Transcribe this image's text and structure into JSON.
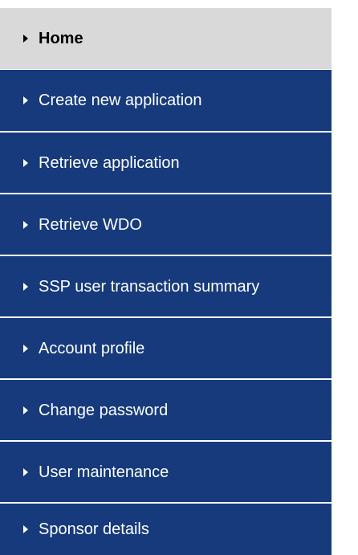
{
  "menu": {
    "colors": {
      "active_bg": "#d9d9d9",
      "active_text": "#000000",
      "item_bg": "#163a7b",
      "item_text": "#ffffff",
      "separator": "#ffffff"
    },
    "items": [
      {
        "label": "Home",
        "active": true,
        "icon": "triangle-right-icon"
      },
      {
        "label": "Create new application",
        "active": false,
        "icon": "triangle-right-icon"
      },
      {
        "label": "Retrieve application",
        "active": false,
        "icon": "triangle-right-icon"
      },
      {
        "label": "Retrieve WDO",
        "active": false,
        "icon": "triangle-right-icon"
      },
      {
        "label": "SSP user transaction summary",
        "active": false,
        "icon": "triangle-right-icon"
      },
      {
        "label": "Account profile",
        "active": false,
        "icon": "triangle-right-icon"
      },
      {
        "label": "Change password",
        "active": false,
        "icon": "triangle-right-icon"
      },
      {
        "label": "User maintenance",
        "active": false,
        "icon": "triangle-right-icon"
      },
      {
        "label": "Sponsor details",
        "active": false,
        "icon": "triangle-right-icon"
      }
    ]
  }
}
